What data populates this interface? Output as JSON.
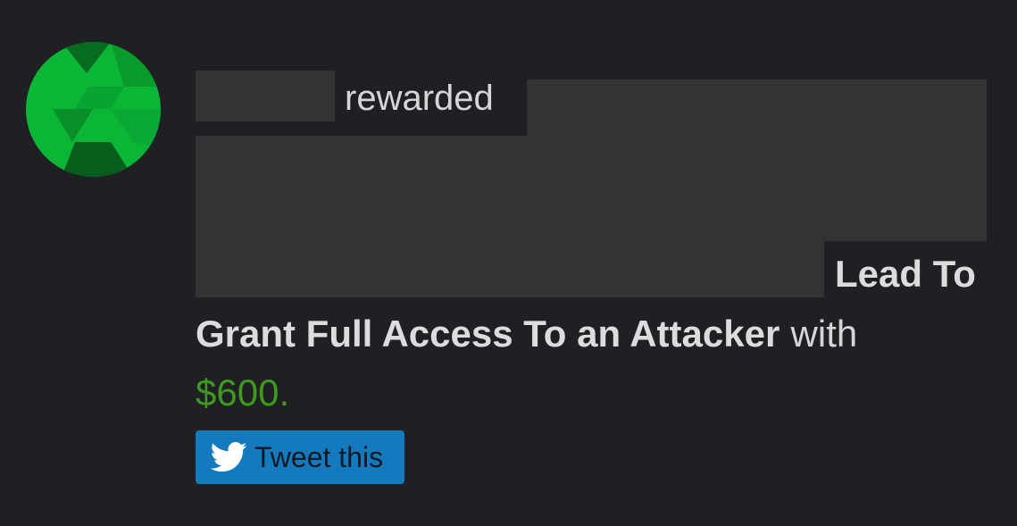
{
  "activity": {
    "reward_verb": "rewarded",
    "title_tail_line1": "Lead To",
    "title_tail_line2": "Grant Full Access To an Attacker",
    "connector": "with",
    "amount": "$600",
    "period": "."
  },
  "tweet_button": {
    "label": "Tweet this",
    "icon": "twitter-bird-icon"
  },
  "colors": {
    "background": "#1f2023",
    "redaction": "#333334",
    "amount": "#3e9a1e",
    "tweet_button": "#1479bd",
    "avatar_green": "#0aa534"
  }
}
